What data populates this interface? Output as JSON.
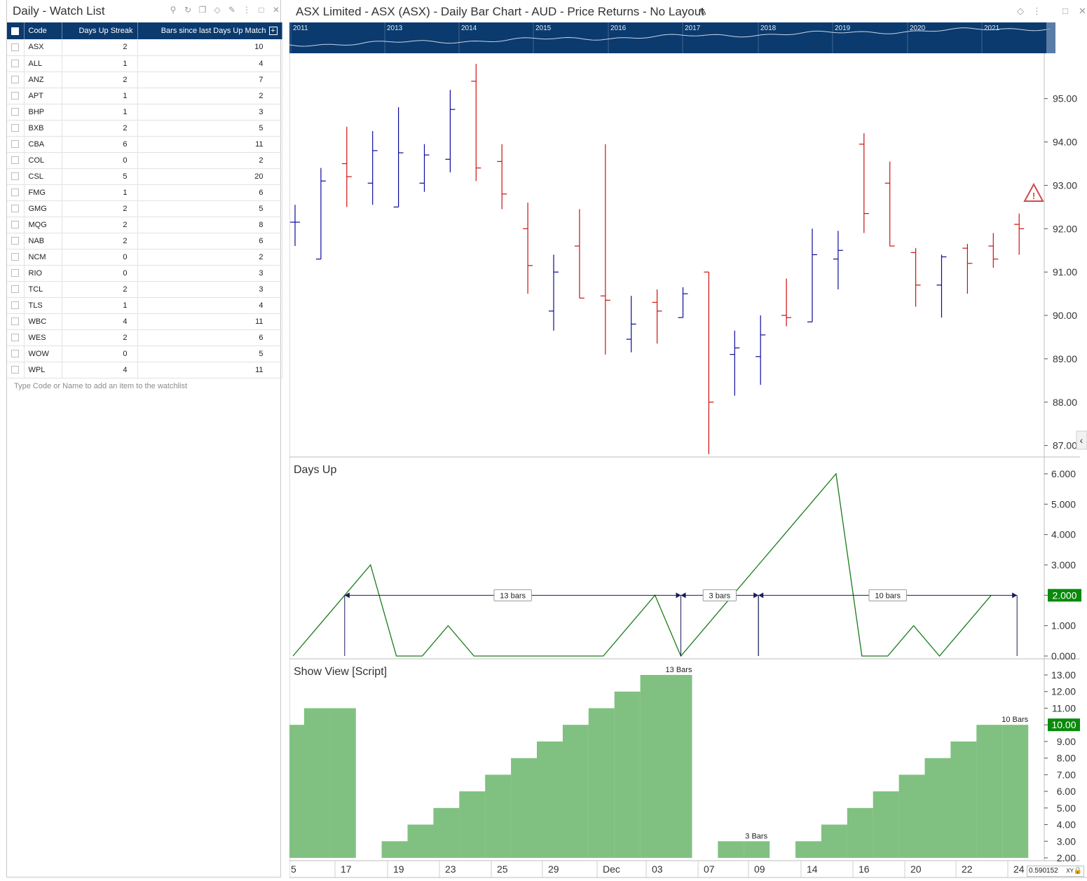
{
  "watchlist": {
    "title": "Daily - Watch List",
    "columns": {
      "code": "Code",
      "streak": "Days Up Streak",
      "bars": "Bars since last Days Up Match"
    },
    "rows": [
      {
        "code": "ASX",
        "streak": "2",
        "bars": "10"
      },
      {
        "code": "ALL",
        "streak": "1",
        "bars": "4"
      },
      {
        "code": "ANZ",
        "streak": "2",
        "bars": "7"
      },
      {
        "code": "APT",
        "streak": "1",
        "bars": "2"
      },
      {
        "code": "BHP",
        "streak": "1",
        "bars": "3"
      },
      {
        "code": "BXB",
        "streak": "2",
        "bars": "5"
      },
      {
        "code": "CBA",
        "streak": "6",
        "bars": "11"
      },
      {
        "code": "COL",
        "streak": "0",
        "bars": "2"
      },
      {
        "code": "CSL",
        "streak": "5",
        "bars": "20"
      },
      {
        "code": "FMG",
        "streak": "1",
        "bars": "6"
      },
      {
        "code": "GMG",
        "streak": "2",
        "bars": "5"
      },
      {
        "code": "MQG",
        "streak": "2",
        "bars": "8"
      },
      {
        "code": "NAB",
        "streak": "2",
        "bars": "6"
      },
      {
        "code": "NCM",
        "streak": "0",
        "bars": "2"
      },
      {
        "code": "RIO",
        "streak": "0",
        "bars": "3"
      },
      {
        "code": "TCL",
        "streak": "2",
        "bars": "3"
      },
      {
        "code": "TLS",
        "streak": "1",
        "bars": "4"
      },
      {
        "code": "WBC",
        "streak": "4",
        "bars": "11"
      },
      {
        "code": "WES",
        "streak": "2",
        "bars": "6"
      },
      {
        "code": "WOW",
        "streak": "0",
        "bars": "5"
      },
      {
        "code": "WPL",
        "streak": "4",
        "bars": "11"
      }
    ],
    "add_hint": "Type Code or Name to add an item to the watchlist"
  },
  "chart": {
    "title": "ASX Limited - ASX (ASX) - Daily Bar Chart - AUD - Price Returns - No Layout",
    "overview_years": [
      "2011",
      "2013",
      "2014",
      "2015",
      "2016",
      "2017",
      "2018",
      "2019",
      "2020",
      "2021"
    ],
    "x_labels": [
      "5",
      "17",
      "19",
      "23",
      "25",
      "29",
      "Dec",
      "03",
      "07",
      "09",
      "14",
      "16",
      "20",
      "22",
      "24"
    ],
    "xy_readout": "0.590152",
    "xy_label": "XY",
    "colors": {
      "up": "#0a0a9e",
      "down": "#cc1111",
      "line": "#1a7a1a",
      "hist": "#80c080",
      "overview_bg": "#0b3a6e",
      "badge": "#0a8a0a"
    }
  },
  "chart_data": [
    {
      "type": "ohlc",
      "title": "",
      "ylim": [
        86.8,
        95.9
      ],
      "y_ticks": [
        "95.00",
        "94.00",
        "93.00",
        "92.00",
        "91.00",
        "90.00",
        "89.00",
        "88.00",
        "87.00"
      ],
      "bars": [
        {
          "o": 92.15,
          "h": 92.55,
          "l": 91.6,
          "c": 92.15,
          "dir": "up"
        },
        {
          "o": 91.3,
          "h": 93.4,
          "l": 91.3,
          "c": 93.1,
          "dir": "up"
        },
        {
          "o": 93.5,
          "h": 94.35,
          "l": 92.5,
          "c": 93.2,
          "dir": "down"
        },
        {
          "o": 93.05,
          "h": 94.25,
          "l": 92.55,
          "c": 93.8,
          "dir": "up"
        },
        {
          "o": 92.5,
          "h": 94.8,
          "l": 92.5,
          "c": 93.75,
          "dir": "up"
        },
        {
          "o": 93.05,
          "h": 93.95,
          "l": 92.85,
          "c": 93.7,
          "dir": "up"
        },
        {
          "o": 93.6,
          "h": 95.2,
          "l": 93.3,
          "c": 94.75,
          "dir": "up"
        },
        {
          "o": 95.4,
          "h": 95.8,
          "l": 93.1,
          "c": 93.4,
          "dir": "down"
        },
        {
          "o": 93.55,
          "h": 93.95,
          "l": 92.45,
          "c": 92.8,
          "dir": "down"
        },
        {
          "o": 92.0,
          "h": 92.6,
          "l": 90.5,
          "c": 91.15,
          "dir": "down"
        },
        {
          "o": 90.1,
          "h": 91.4,
          "l": 89.65,
          "c": 91.0,
          "dir": "up"
        },
        {
          "o": 91.6,
          "h": 92.45,
          "l": 90.4,
          "c": 90.4,
          "dir": "down"
        },
        {
          "o": 90.45,
          "h": 93.95,
          "l": 89.1,
          "c": 90.35,
          "dir": "down"
        },
        {
          "o": 89.45,
          "h": 90.45,
          "l": 89.15,
          "c": 89.8,
          "dir": "up"
        },
        {
          "o": 90.3,
          "h": 90.6,
          "l": 89.35,
          "c": 90.1,
          "dir": "down"
        },
        {
          "o": 89.95,
          "h": 90.65,
          "l": 89.95,
          "c": 90.5,
          "dir": "up"
        },
        {
          "o": 91.0,
          "h": 91.0,
          "l": 86.8,
          "c": 88.0,
          "dir": "down"
        },
        {
          "o": 89.1,
          "h": 89.65,
          "l": 88.15,
          "c": 89.25,
          "dir": "up"
        },
        {
          "o": 89.05,
          "h": 90.0,
          "l": 88.4,
          "c": 89.55,
          "dir": "up"
        },
        {
          "o": 90.0,
          "h": 90.85,
          "l": 89.75,
          "c": 89.95,
          "dir": "down"
        },
        {
          "o": 89.85,
          "h": 92.0,
          "l": 89.85,
          "c": 91.4,
          "dir": "up"
        },
        {
          "o": 91.3,
          "h": 91.95,
          "l": 90.6,
          "c": 91.5,
          "dir": "up"
        },
        {
          "o": 93.95,
          "h": 94.2,
          "l": 91.9,
          "c": 92.35,
          "dir": "down"
        },
        {
          "o": 93.05,
          "h": 93.55,
          "l": 91.6,
          "c": 91.6,
          "dir": "down"
        },
        {
          "o": 91.45,
          "h": 91.55,
          "l": 90.2,
          "c": 90.7,
          "dir": "down"
        },
        {
          "o": 90.7,
          "h": 91.4,
          "l": 89.95,
          "c": 91.35,
          "dir": "up"
        },
        {
          "o": 91.55,
          "h": 91.65,
          "l": 90.5,
          "c": 91.2,
          "dir": "down"
        },
        {
          "o": 91.6,
          "h": 91.9,
          "l": 91.1,
          "c": 91.3,
          "dir": "down"
        },
        {
          "o": 92.1,
          "h": 92.35,
          "l": 91.4,
          "c": 92.0,
          "dir": "down"
        }
      ]
    },
    {
      "type": "line",
      "title": "Days Up",
      "ylim": [
        0,
        6.2
      ],
      "y_ticks": [
        "6.000",
        "5.000",
        "4.000",
        "3.000",
        "2.000",
        "1.000",
        "0.000"
      ],
      "values": [
        0,
        1,
        2,
        3,
        0,
        0,
        1,
        0,
        0,
        0,
        0,
        0,
        0,
        1,
        2,
        0,
        1,
        2,
        3,
        4,
        5,
        6,
        0,
        0,
        1,
        0,
        1,
        2
      ],
      "last_value": "2.000",
      "annotations": [
        {
          "from": 2,
          "to": 15,
          "level": 2,
          "label": "13 bars"
        },
        {
          "from": 15,
          "to": 18,
          "level": 2,
          "label": "3 bars"
        },
        {
          "from": 18,
          "to": 28,
          "level": 2,
          "label": "10 bars"
        }
      ]
    },
    {
      "type": "bar",
      "title": "Show View [Script]",
      "ylim": [
        2,
        13.4
      ],
      "y_ticks": [
        "13.00",
        "12.00",
        "11.00",
        "10.00",
        "9.00",
        "8.00",
        "7.00",
        "6.00",
        "5.00",
        "4.00",
        "3.00",
        "2.00"
      ],
      "values": [
        10,
        11,
        11,
        null,
        3,
        4,
        5,
        6,
        7,
        8,
        9,
        10,
        11,
        12,
        13,
        13,
        null,
        3,
        3,
        null,
        3,
        4,
        5,
        6,
        7,
        8,
        9,
        10,
        10
      ],
      "last_value": "10.00",
      "labels": [
        {
          "index": 15,
          "text": "13 Bars"
        },
        {
          "index": 18,
          "text": "3 Bars"
        },
        {
          "index": 28,
          "text": "10 Bars"
        }
      ]
    }
  ]
}
